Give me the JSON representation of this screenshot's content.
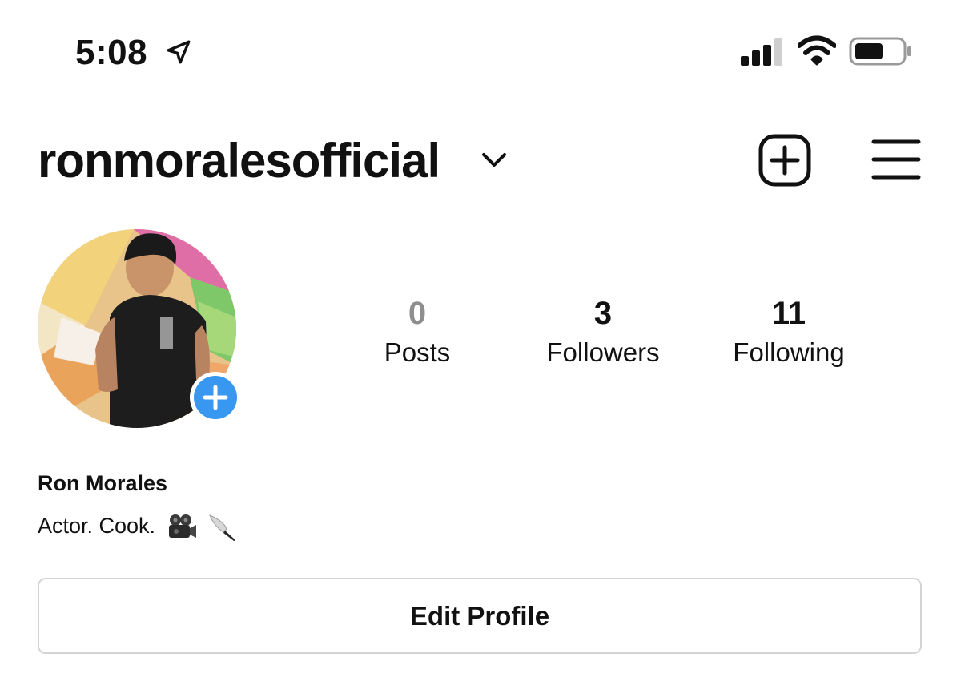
{
  "status_bar": {
    "time": "5:08",
    "icons": [
      "location-arrow-icon",
      "cellular-signal-icon",
      "wifi-icon",
      "battery-icon"
    ]
  },
  "header": {
    "username": "ronmoralesofficial",
    "icons": [
      "chevron-down-icon",
      "new-post-icon",
      "menu-icon"
    ]
  },
  "profile": {
    "stats": {
      "posts": {
        "value": "0",
        "label": "Posts"
      },
      "followers": {
        "value": "3",
        "label": "Followers"
      },
      "following": {
        "value": "11",
        "label": "Following"
      }
    },
    "full_name": "Ron Morales",
    "bio": "Actor. Cook.",
    "bio_emojis": [
      "movie-camera-icon",
      "kitchen-knife-icon"
    ]
  },
  "actions": {
    "edit_profile": "Edit Profile"
  },
  "colors": {
    "accent_blue": "#3897f0",
    "posts_count_gray": "#8e8e8e",
    "button_border": "#d4d4d4"
  }
}
